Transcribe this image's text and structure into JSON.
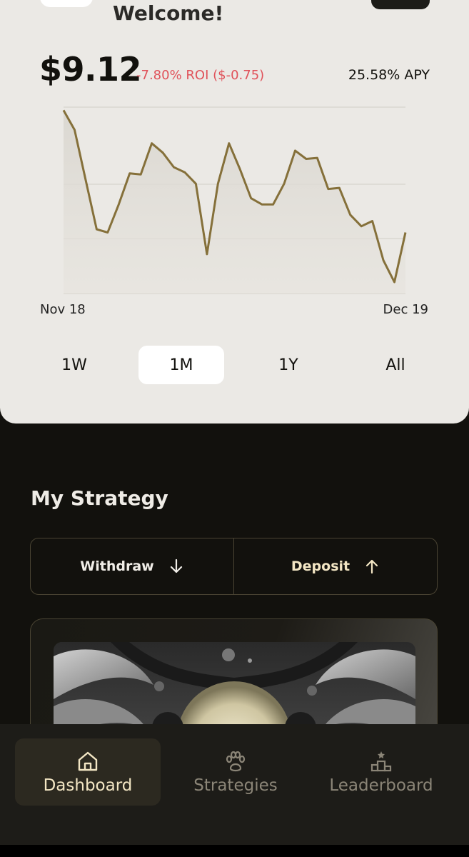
{
  "header": {
    "welcome": "Welcome!"
  },
  "portfolio": {
    "balance": "$9.12",
    "roi": "-7.80% ROI ($-0.75)",
    "apy": "25.58% APY"
  },
  "chart_data": {
    "type": "area",
    "start_label": "Nov 18",
    "end_label": "Dec 19",
    "values": [
      9.87,
      9.68,
      9.2,
      8.72,
      8.69,
      8.96,
      9.26,
      9.25,
      9.55,
      9.46,
      9.32,
      9.27,
      9.16,
      8.48,
      9.16,
      9.55,
      9.3,
      9.02,
      8.96,
      8.96,
      9.16,
      9.48,
      9.4,
      9.41,
      9.11,
      9.12,
      8.86,
      8.75,
      8.8,
      8.42,
      8.21,
      8.69
    ],
    "ylim": [
      8.1,
      9.9
    ],
    "grid": true,
    "line_color": "#85703a"
  },
  "ranges": {
    "w1": "1W",
    "m1": "1M",
    "y1": "1Y",
    "all": "All",
    "selected": "1M"
  },
  "strategy": {
    "title": "My Strategy",
    "withdraw": "Withdraw",
    "deposit": "Deposit"
  },
  "nav": {
    "dashboard": "Dashboard",
    "strategies": "Strategies",
    "leaderboard": "Leaderboard",
    "active": "Dashboard"
  },
  "colors": {
    "accent": "#f3e6c4",
    "negative": "#e0525a",
    "background": "#12110d",
    "card": "#ebe9e5"
  }
}
